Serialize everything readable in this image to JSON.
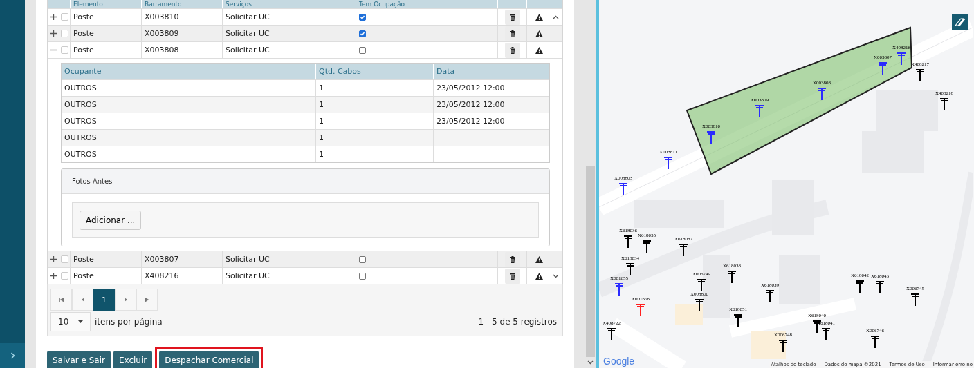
{
  "table": {
    "columns": [
      "Elemento",
      "Barramento",
      "Serviços",
      "Tem Ocupação"
    ],
    "rows": [
      {
        "expanded": false,
        "selected": false,
        "element": "Poste",
        "busbar": "X003810",
        "service": "Solicitar UC",
        "occupied": true
      },
      {
        "expanded": false,
        "selected": false,
        "element": "Poste",
        "busbar": "X003809",
        "service": "Solicitar UC",
        "occupied": true
      },
      {
        "expanded": true,
        "selected": false,
        "element": "Poste",
        "busbar": "X003808",
        "service": "Solicitar UC",
        "occupied": false
      },
      {
        "expanded": false,
        "selected": false,
        "element": "Poste",
        "busbar": "X003807",
        "service": "Solicitar UC",
        "occupied": false
      },
      {
        "expanded": false,
        "selected": false,
        "element": "Poste",
        "busbar": "X408216",
        "service": "Solicitar UC",
        "occupied": false
      }
    ],
    "detail": {
      "columns": [
        "Ocupante",
        "Qtd. Cabos",
        "Data"
      ],
      "rows": [
        [
          "OUTROS",
          "1",
          "23/05/2012 12:00"
        ],
        [
          "OUTROS",
          "1",
          "23/05/2012 12:00"
        ],
        [
          "OUTROS",
          "1",
          "23/05/2012 12:00"
        ],
        [
          "OUTROS",
          "1",
          ""
        ],
        [
          "OUTROS",
          "1",
          ""
        ]
      ],
      "photos_title": "Fotos Antes",
      "add_button": "Adicionar ..."
    }
  },
  "pager": {
    "pages": [
      {
        "label": "1",
        "selected": true
      }
    ],
    "page_size": "10",
    "page_size_label": "itens por página",
    "summary": "1 - 5 de 5 registros"
  },
  "actions": [
    {
      "label": "Salvar e Sair",
      "highlighted": false
    },
    {
      "label": "Excluir",
      "highlighted": false
    },
    {
      "label": "Despachar Comercial",
      "highlighted": true
    }
  ],
  "map": {
    "poles": [
      {
        "label": "X003810",
        "color": "#2b2bff"
      },
      {
        "label": "X003809",
        "color": "#2b2bff"
      },
      {
        "label": "X003808",
        "color": "#2b2bff"
      },
      {
        "label": "X003807",
        "color": "#2b2bff"
      },
      {
        "label": "X408216",
        "color": "#2b2bff"
      },
      {
        "label": "X408217",
        "color": "#000000"
      },
      {
        "label": "X408218",
        "color": "#000000"
      },
      {
        "label": "X003811",
        "color": "#2b2bff"
      },
      {
        "label": "X003803",
        "color": "#2b2bff"
      },
      {
        "label": "X618036",
        "color": "#000000"
      },
      {
        "label": "X618035",
        "color": "#000000"
      },
      {
        "label": "X618037",
        "color": "#000000"
      },
      {
        "label": "X618034",
        "color": "#000000"
      },
      {
        "label": "X001655",
        "color": "#2b2bff"
      },
      {
        "label": "X006749",
        "color": "#000000"
      },
      {
        "label": "X618038",
        "color": "#000000"
      },
      {
        "label": "X618039",
        "color": "#000000"
      },
      {
        "label": "X003800",
        "color": "#000000"
      },
      {
        "label": "X001656",
        "color": "#ff2020"
      },
      {
        "label": "X618051",
        "color": "#000000"
      },
      {
        "label": "X618040",
        "color": "#000000"
      },
      {
        "label": "X618041",
        "color": "#000000"
      },
      {
        "label": "X006748",
        "color": "#000000"
      },
      {
        "label": "X006746",
        "color": "#000000"
      },
      {
        "label": "X006745",
        "color": "#000000"
      },
      {
        "label": "X618042",
        "color": "#000000"
      },
      {
        "label": "X618043",
        "color": "#000000"
      },
      {
        "label": "X408722",
        "color": "#000000"
      }
    ],
    "logo": "Google",
    "attribution": [
      "Atalhos do teclado",
      "Dados do mapa ©2021",
      "Termos de Uso",
      "Informar erro no"
    ]
  }
}
